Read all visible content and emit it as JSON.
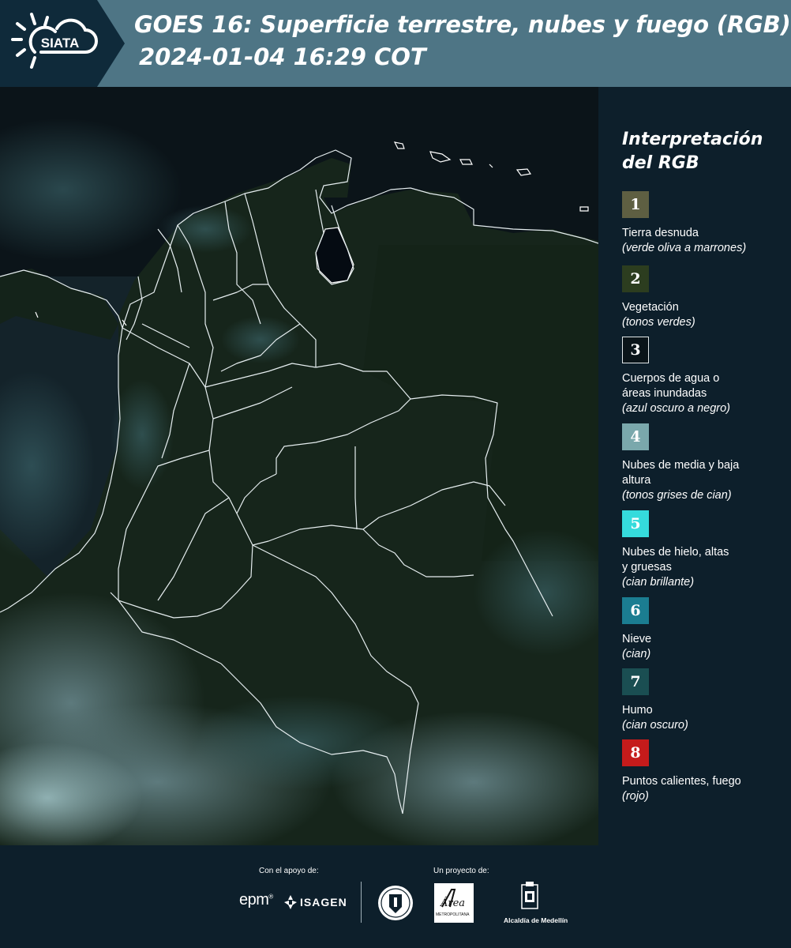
{
  "header": {
    "logo_text": "SIATA",
    "title": "GOES 16: Superficie terrestre, nubes y fuego (RGB)",
    "timestamp": "2024-01-04 16:29 COT",
    "colors": {
      "header_bg": "#4e7585",
      "logo_bg": "#0f2a3a"
    }
  },
  "legend": {
    "title_line1": "Interpretación",
    "title_line2": "del RGB",
    "items": [
      {
        "number": "1",
        "label": "Tierra desnuda",
        "hint": "(verde oliva a marrones)",
        "color": "#5e5f42"
      },
      {
        "number": "2",
        "label": "Vegetación",
        "hint": "(tonos verdes)",
        "color": "#2c3d1f"
      },
      {
        "number": "3",
        "label": "Cuerpos de agua o áreas inundadas",
        "hint": "(azul oscuro a negro)",
        "color": "#0a1419"
      },
      {
        "number": "4",
        "label": "Nubes de media y baja altura",
        "hint": "(tonos grises de cian)",
        "color": "#7aa8ac"
      },
      {
        "number": "5",
        "label": "Nubes de hielo, altas y gruesas",
        "hint": "(cian brillante)",
        "color": "#35dbdc"
      },
      {
        "number": "6",
        "label": "Nieve",
        "hint": "(cian)",
        "color": "#1b7d91"
      },
      {
        "number": "7",
        "label": "Humo",
        "hint": "(cian oscuro)",
        "color": "#1a4e52"
      },
      {
        "number": "8",
        "label": "Puntos calientes, fuego",
        "hint": "(rojo)",
        "color": "#c51b1b"
      }
    ]
  },
  "footer": {
    "support_label": "Con el apoyo de:",
    "project_label": "Un proyecto de:",
    "epm_logo": "epm",
    "isagen_logo": "ISAGEN",
    "area_logo_text": "Área",
    "area_logo_subtext": "METROPOLITANA",
    "alcaldia_logo": "Alcaldía de Medellín"
  }
}
